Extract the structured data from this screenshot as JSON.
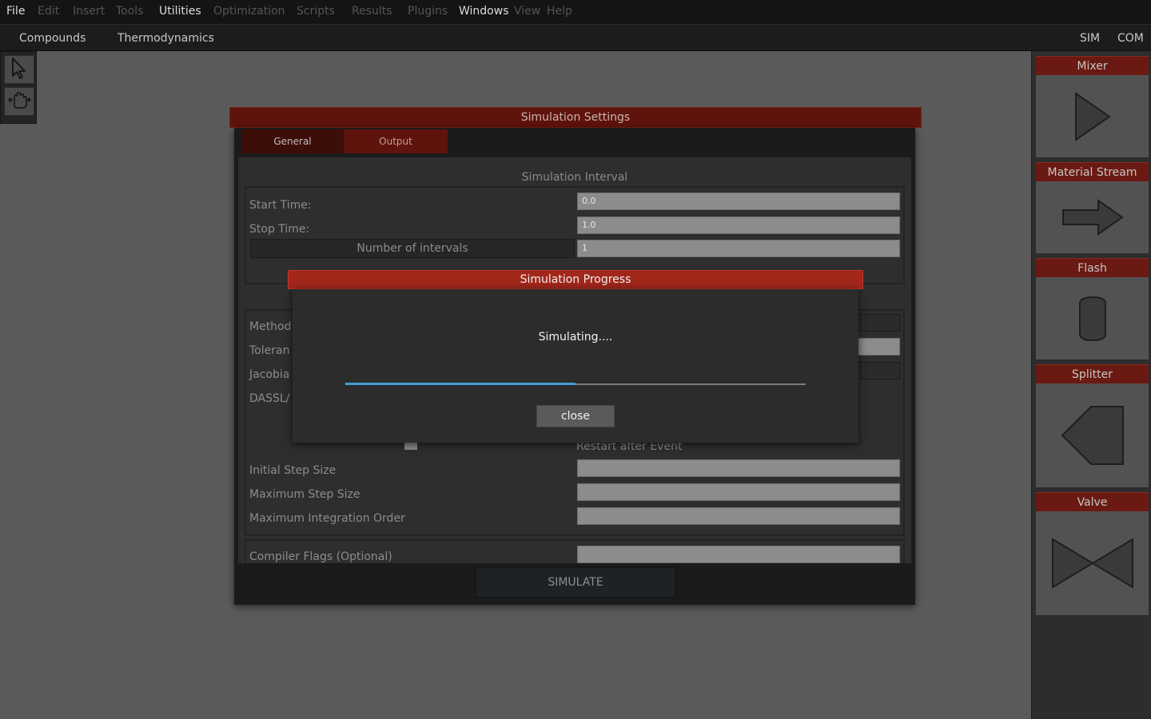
{
  "menu": {
    "file": "File",
    "edit": "Edit",
    "insert": "Insert",
    "tools": "Tools",
    "utilities": "Utilities",
    "optimization": "Optimization",
    "scripts": "Scripts",
    "results": "Results",
    "plugins": "Plugins",
    "windows": "Windows",
    "view": "View",
    "help": "Help"
  },
  "toolbar": {
    "compounds": "Compounds",
    "thermodynamics": "Thermodynamics",
    "sim": "SIM",
    "com": "COM"
  },
  "tools": {
    "select_icon": "pointer-icon",
    "pan_icon": "hand-icon"
  },
  "components": [
    {
      "title": "Mixer",
      "icon": "mixer-icon"
    },
    {
      "title": "Material Stream",
      "icon": "arrow-icon"
    },
    {
      "title": "Flash",
      "icon": "flash-drum-icon"
    },
    {
      "title": "Splitter",
      "icon": "splitter-icon"
    },
    {
      "title": "Valve",
      "icon": "valve-icon"
    }
  ],
  "settings": {
    "title": "Simulation Settings",
    "tabs": {
      "general": "General",
      "output": "Output"
    },
    "interval_title": "Simulation Interval",
    "start_time_label": "Start Time:",
    "start_time_value": "0.0",
    "stop_time_label": "Stop Time:",
    "stop_time_value": "1.0",
    "nintervals_label": "Number of intervals",
    "nintervals_value": "1",
    "method_label": "Method",
    "tolerance_label": "Toleran",
    "jacobian_label": "Jacobia",
    "dassl_label": "DASSL/",
    "restart_label": "Restart after Event",
    "initial_step_label": "Initial Step Size",
    "max_step_label": "Maximum Step Size",
    "max_order_label": "Maximum Integration Order",
    "compiler_flags_label": "Compiler Flags (Optional)",
    "simulate_label": "SIMULATE"
  },
  "progress_dialog": {
    "title": "Simulation Progress",
    "message": "Simulating....",
    "progress_fraction": 0.5,
    "close_label": "close"
  },
  "colors": {
    "accent_red": "#a2271b",
    "progress_blue": "#3f9fd6"
  }
}
